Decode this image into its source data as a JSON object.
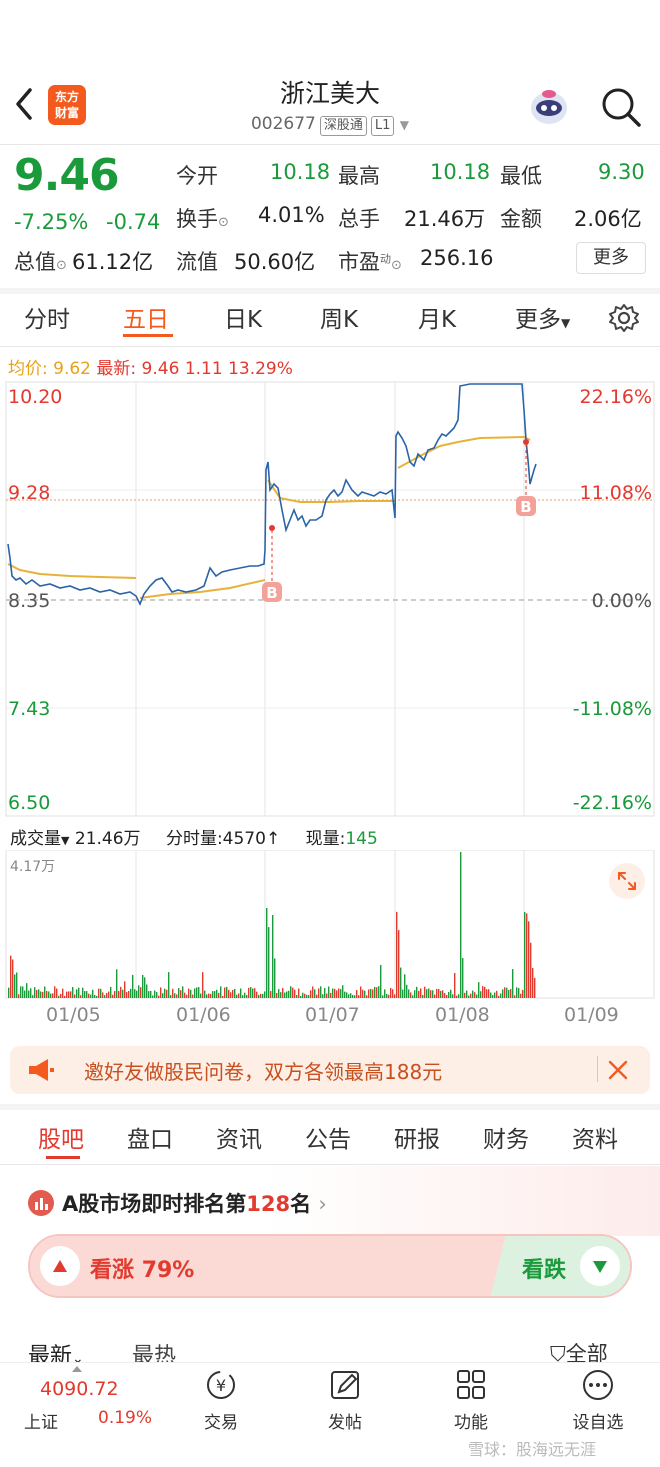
{
  "header": {
    "title": "浙江美大",
    "code": "002677",
    "tag_exchange": "深股通",
    "tag_level": "L1",
    "logo_text_1": "东方",
    "logo_text_2": "财富"
  },
  "quote": {
    "price": "9.46",
    "change_pct": "-7.25%",
    "change": "-0.74",
    "open_label": "今开",
    "open": "10.18",
    "high_label": "最高",
    "high": "10.18",
    "low_label": "最低",
    "low": "9.30",
    "turnover_label": "换手",
    "turnover": "4.01%",
    "volume_label": "总手",
    "volume": "21.46万",
    "amount_label": "金额",
    "amount": "2.06亿",
    "mktcap_label": "总值",
    "mktcap": "61.12亿",
    "float_label": "流值",
    "float_cap": "50.60亿",
    "pe_label": "市盈",
    "pe_sup": "动",
    "pe": "256.16",
    "more_label": "更多"
  },
  "chart_tabs": [
    "分时",
    "五日",
    "日K",
    "周K",
    "月K",
    "更多"
  ],
  "chart_tabs_active": 1,
  "chart_legend": {
    "avg_label": "均价:",
    "avg": "9.62",
    "latest_label": "最新:",
    "latest": "9.46",
    "change": "1.11",
    "pct": "13.29%"
  },
  "axis_left": [
    "10.20",
    "9.28",
    "8.35",
    "7.43",
    "6.50"
  ],
  "axis_right": [
    "22.16%",
    "11.08%",
    "0.00%",
    "-11.08%",
    "-22.16%"
  ],
  "buy_marker": "B",
  "volume_legend": {
    "label": "成交量",
    "total": "21.46万",
    "tick_label": "分时量:4570",
    "now_label": "现量:",
    "now": "145",
    "max": "4.17万"
  },
  "dates": [
    "01/05",
    "01/06",
    "01/07",
    "01/08",
    "01/09"
  ],
  "banner": {
    "text": "邀好友做股民问卷，双方各领最高188元"
  },
  "bottom_tabs": [
    "股吧",
    "盘口",
    "资讯",
    "公告",
    "研报",
    "财务",
    "资料"
  ],
  "bottom_tabs_active": 0,
  "rank": {
    "prefix": "A股市场即时排名第",
    "num": "128",
    "suffix": "名"
  },
  "vote": {
    "up_label": "看涨",
    "up_pct": "79%",
    "down_label": "看跌"
  },
  "feed_sort": {
    "latest": "最新",
    "hot": "最热",
    "filter": "全部"
  },
  "nav": {
    "index_value": "4090.72",
    "index_name": "上证",
    "index_pct": "0.19%",
    "items": [
      "交易",
      "发帖",
      "功能",
      "设自选"
    ]
  },
  "watermark": "雪球：股海远无涯",
  "colors": {
    "accent": "#f45a1e",
    "up": "#e23a2e",
    "down": "#1a9a3a",
    "line": "#2a64a8",
    "avg": "#e8b23a"
  }
}
